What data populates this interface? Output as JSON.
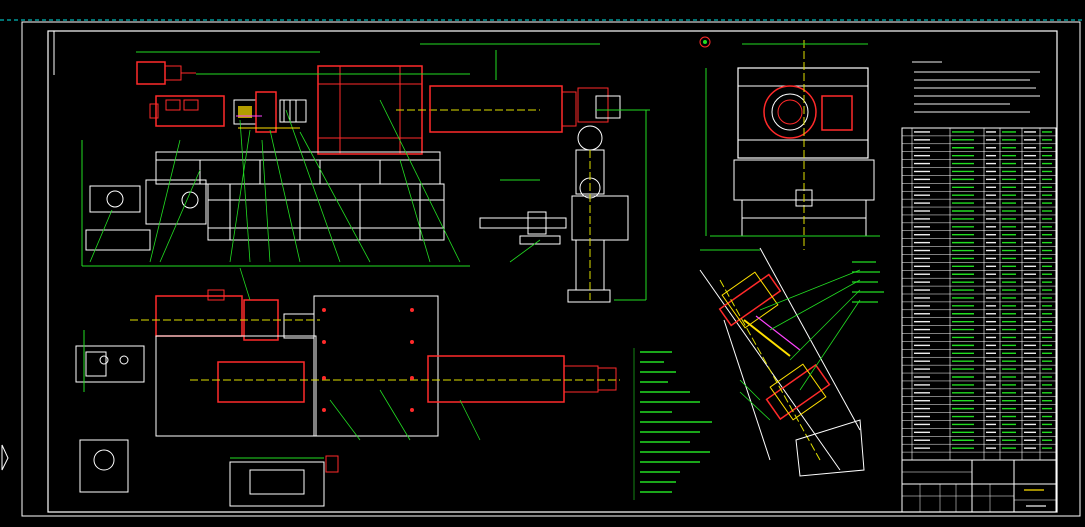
{
  "colors": {
    "background": "#000000",
    "frame": "#ffffff",
    "part": "#ff2a2a",
    "dimension": "#22dd22",
    "detail": "#ffffff",
    "centerline": "#e0e000",
    "accent": "#ff44ff",
    "hidden": "#00e5e5"
  },
  "drawing": {
    "dim_top": "",
    "dim_bottom": "",
    "title_block_code": "",
    "scale_text": ""
  }
}
